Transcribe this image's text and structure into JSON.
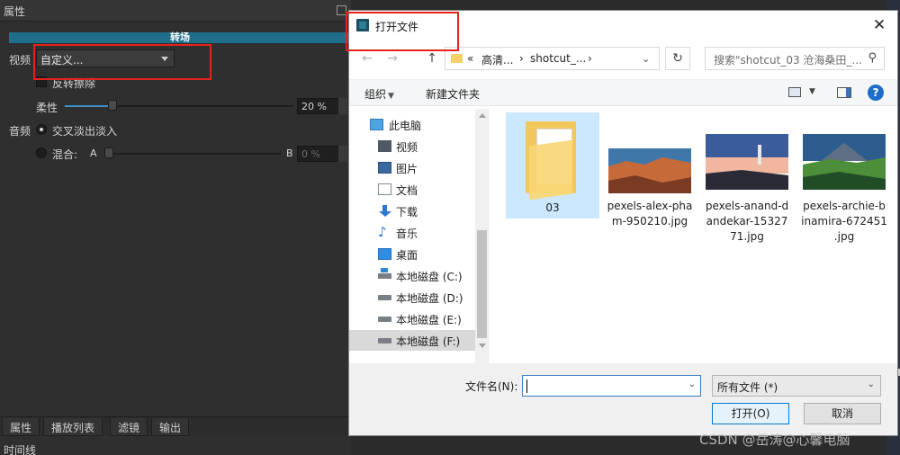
{
  "left_panel": {
    "header_title": "属性",
    "section_title": "转场",
    "video_label": "视频",
    "video_combo_value": "自定义...",
    "invert_wipe_label": "反转擦除",
    "softness_label": "柔性",
    "softness_value": "20 %",
    "softness_level": 0.2,
    "audio_label": "音频",
    "crossfade_label": "交叉淡出淡入",
    "mix_label": "混合:",
    "mix_a": "A",
    "mix_b": "B",
    "mix_value": "0 %",
    "bottom_tabs": [
      "属性",
      "播放列表",
      "滤镜",
      "输出"
    ],
    "timeline_label": "时间线"
  },
  "dialog": {
    "title": "打开文件",
    "close_glyph": "✕",
    "nav": {
      "back_glyph": "←",
      "forward_glyph": "→",
      "up_glyph": "↑",
      "address_parts": [
        "«",
        "高清...",
        "›",
        "shotcut_...",
        "›"
      ],
      "address_drop": "⌄",
      "refresh_glyph": "↻",
      "search_placeholder": "搜索\"shotcut_03 沧海桑田_...",
      "search_glyph": "⚲"
    },
    "toolbar": {
      "organize": "组织",
      "organize_caret": "▼",
      "new_folder": "新建文件夹",
      "view_caret": "▼",
      "help": "?"
    },
    "tree": [
      {
        "label": "此电脑",
        "icon": "computer-icon"
      },
      {
        "label": "视频",
        "icon": "video-folder-icon"
      },
      {
        "label": "图片",
        "icon": "pictures-folder-icon"
      },
      {
        "label": "文档",
        "icon": "documents-folder-icon"
      },
      {
        "label": "下载",
        "icon": "download-icon"
      },
      {
        "label": "音乐",
        "icon": "music-icon"
      },
      {
        "label": "桌面",
        "icon": "desktop-icon"
      },
      {
        "label": "本地磁盘 (C:)",
        "icon": "system-drive-icon"
      },
      {
        "label": "本地磁盘 (D:)",
        "icon": "drive-icon"
      },
      {
        "label": "本地磁盘 (E:)",
        "icon": "drive-icon"
      },
      {
        "label": "本地磁盘 (F:)",
        "icon": "drive-icon"
      }
    ],
    "files": [
      {
        "name": "03",
        "type": "folder"
      },
      {
        "name": "pexels-alex-pham-950210.jpg",
        "type": "image",
        "colors": [
          "#3f78a8",
          "#c76a3a",
          "#7a3b22"
        ]
      },
      {
        "name": "pexels-anand-dandekar-1532771.jpg",
        "type": "image",
        "colors": [
          "#3b5c9a",
          "#f0b6a0",
          "#2b2b38"
        ]
      },
      {
        "name": "pexels-archie-binamira-672451.jpg",
        "type": "image",
        "colors": [
          "#2c5d8e",
          "#4d8e3a",
          "#214d26"
        ]
      }
    ],
    "file_name_display": [
      [
        "03"
      ],
      [
        "pexels-alex-pha",
        "m-950210.jpg"
      ],
      [
        "pexels-anand-d",
        "andekar-15327",
        "71.jpg"
      ],
      [
        "pexels-archie-b",
        "inamira-672451",
        ".jpg"
      ]
    ],
    "filename_label": "文件名(N):",
    "filename_value": "",
    "filetype_value": "所有文件 (*)",
    "open_button": "打开(O)",
    "cancel_button": "取消"
  },
  "watermark": "CSDN @岳涛@心馨电脑"
}
